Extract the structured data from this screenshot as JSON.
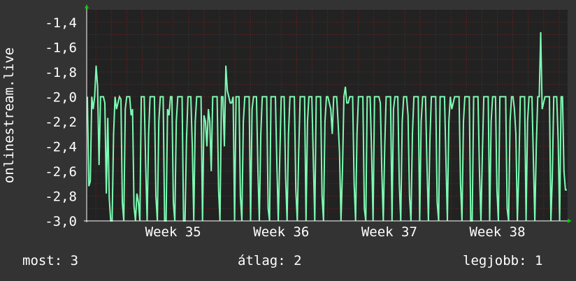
{
  "chart_data": {
    "type": "line",
    "ylabel": "onlinestream.live",
    "ylim": [
      -3.0,
      -1.3
    ],
    "yticks": [
      "-1,4",
      "-1,6",
      "-1,8",
      "-2,0",
      "-2,2",
      "-2,4",
      "-2,6",
      "-2,8",
      "-3,0"
    ],
    "ytick_values": [
      -1.4,
      -1.6,
      -1.8,
      -2.0,
      -2.2,
      -2.4,
      -2.6,
      -2.8,
      -3.0
    ],
    "xticks": [
      "Week 35",
      "Week 36",
      "Week 37",
      "Week 38"
    ],
    "xrange_weeks": [
      34.2,
      38.65
    ],
    "grid": true,
    "colors": {
      "background": "#333333",
      "plot": "#222222",
      "line": "#7dfcb4",
      "grid": "#6b2626",
      "axis": "#ffffff",
      "arrow": "#00cc00"
    },
    "series": [
      {
        "values": [
          -2.0,
          -2.72,
          -2.68,
          -2.0,
          -2.1,
          -2.0,
          -1.75,
          -1.92,
          -2.55,
          -2.0,
          -2.0,
          -2.0,
          -2.05,
          -2.78,
          -2.17,
          -2.82,
          -3.0,
          -3.0,
          -2.3,
          -2.0,
          -2.1,
          -2.05,
          -2.0,
          -2.02,
          -2.85,
          -3.0,
          -2.1,
          -2.0,
          -2.0,
          -2.0,
          -2.15,
          -2.1,
          -2.88,
          -3.0,
          -2.78,
          -2.85,
          -3.0,
          -2.0,
          -2.0,
          -2.0,
          -2.55,
          -3.0,
          -2.3,
          -2.0,
          -2.0,
          -2.0,
          -2.0,
          -2.8,
          -3.0,
          -2.2,
          -2.0,
          -2.0,
          -2.0,
          -3.0,
          -3.0,
          -2.1,
          -2.15,
          -2.0,
          -2.0,
          -2.85,
          -3.0,
          -2.2,
          -2.0,
          -2.0,
          -2.0,
          -2.0,
          -3.0,
          -3.0,
          -2.35,
          -2.0,
          -2.0,
          -2.0,
          -2.4,
          -3.0,
          -2.2,
          -2.0,
          -2.0,
          -2.0,
          -2.0,
          -3.0,
          -2.15,
          -2.2,
          -2.4,
          -2.1,
          -2.2,
          -2.6,
          -2.0,
          -2.0,
          -2.0,
          -2.0,
          -2.75,
          -3.0,
          -2.0,
          -2.0,
          -2.4,
          -1.75,
          -1.95,
          -2.0,
          -2.05,
          -2.05,
          -2.0,
          -3.0,
          -2.0,
          -2.0,
          -2.0,
          -2.8,
          -3.0,
          -2.2,
          -2.0,
          -2.0,
          -2.0,
          -2.0,
          -3.0,
          -2.1,
          -2.0,
          -2.0,
          -2.0,
          -2.6,
          -3.0,
          -2.3,
          -2.0,
          -2.0,
          -2.0,
          -2.0,
          -2.9,
          -3.0,
          -2.0,
          -2.0,
          -2.0,
          -2.0,
          -2.55,
          -3.0,
          -2.5,
          -2.0,
          -2.0,
          -2.0,
          -2.65,
          -3.0,
          -2.3,
          -2.0,
          -2.0,
          -2.0,
          -2.0,
          -2.75,
          -3.0,
          -2.45,
          -2.0,
          -2.0,
          -2.0,
          -2.0,
          -3.0,
          -2.2,
          -2.0,
          -2.0,
          -2.0,
          -2.5,
          -3.0,
          -2.0,
          -2.0,
          -2.0,
          -2.0,
          -2.8,
          -3.0,
          -2.2,
          -2.0,
          -2.0,
          -2.05,
          -2.1,
          -2.3,
          -2.0,
          -2.0,
          -2.0,
          -2.2,
          -2.45,
          -3.0,
          -2.6,
          -2.0,
          -1.92,
          -2.05,
          -2.05,
          -2.0,
          -2.0,
          -2.0,
          -2.7,
          -3.0,
          -2.3,
          -2.0,
          -2.0,
          -2.0,
          -2.0,
          -2.9,
          -3.0,
          -2.0,
          -2.0,
          -2.0,
          -2.45,
          -3.0,
          -2.0,
          -2.0,
          -2.0,
          -2.0,
          -2.05,
          -2.6,
          -3.0,
          -2.4,
          -2.0,
          -2.0,
          -2.0,
          -2.0,
          -3.0,
          -2.1,
          -2.0,
          -2.0,
          -2.0,
          -2.7,
          -3.0,
          -2.2,
          -2.0,
          -2.0,
          -2.0,
          -2.15,
          -2.8,
          -3.0,
          -2.3,
          -2.0,
          -2.0,
          -2.0,
          -2.0,
          -3.0,
          -2.2,
          -2.0,
          -2.0,
          -2.0,
          -2.55,
          -3.0,
          -2.35,
          -2.0,
          -2.0,
          -2.0,
          -2.0,
          -2.85,
          -3.0,
          -2.0,
          -2.0,
          -2.0,
          -2.0,
          -2.5,
          -3.0,
          -2.2,
          -2.0,
          -2.1,
          -2.05,
          -2.0,
          -2.0,
          -2.0,
          -2.0,
          -2.7,
          -3.0,
          -2.2,
          -2.0,
          -2.0,
          -2.0,
          -2.0,
          -3.0,
          -3.0,
          -2.0,
          -2.0,
          -2.0,
          -2.0,
          -2.6,
          -3.0,
          -2.45,
          -2.0,
          -2.0,
          -2.0,
          -2.0,
          -3.0,
          -2.2,
          -2.0,
          -2.0,
          -2.0,
          -2.75,
          -3.0,
          -2.0,
          -2.0,
          -2.0,
          -2.0,
          -2.0,
          -2.9,
          -3.0,
          -2.2,
          -2.0,
          -2.0,
          -2.1,
          -2.3,
          -3.0,
          -2.6,
          -2.0,
          -2.0,
          -2.0,
          -2.0,
          -3.0,
          -2.2,
          -2.0,
          -2.0,
          -2.0,
          -2.5,
          -3.0,
          -2.4,
          -2.0,
          -2.0,
          -1.48,
          -2.1,
          -2.05,
          -2.0,
          -2.0,
          -2.0,
          -2.0,
          -3.0,
          -2.65,
          -2.0,
          -2.0,
          -2.0,
          -2.35,
          -3.0,
          -2.0,
          -2.0,
          -2.6,
          -2.75,
          -2.75
        ]
      }
    ]
  },
  "legend": {
    "now": "most: 3",
    "avg": "átlag: 2",
    "best": "legjobb: 1"
  }
}
